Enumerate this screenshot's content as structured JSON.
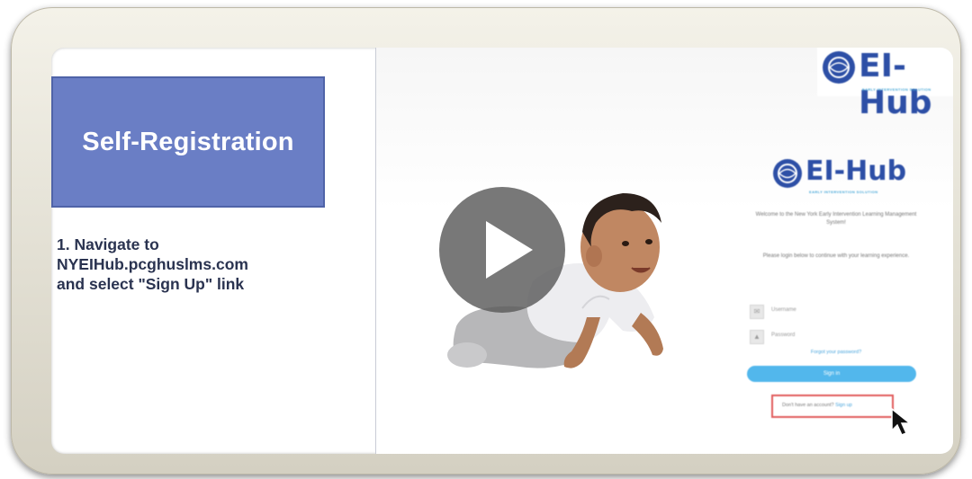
{
  "slide": {
    "title": "Self-Registration",
    "step": "1. Navigate to\nNYEIHub.pcghuslms.com\nand select \"Sign Up\" link"
  },
  "logo": {
    "brand": "EI-Hub",
    "tagline": "EARLY INTERVENTION SOLUTION"
  },
  "login": {
    "welcome": "Welcome to the New York Early Intervention Learning Management System!",
    "instructions": "Please login below to continue with your learning experience.",
    "username_placeholder": "Username",
    "password_placeholder": "Password",
    "forgot_link": "Forgot your password?",
    "signin_button": "Sign in",
    "signup_prompt": "Don't have an account?",
    "signup_link": "Sign up"
  },
  "colors": {
    "title_box": "#6a7ec5",
    "title_text": "#ffffff",
    "step_text": "#2a3350",
    "brand_blue": "#2d4fa6",
    "signin_blue": "#52b7ec",
    "highlight_red": "#e15b5b"
  },
  "icons": {
    "play": "play-icon",
    "cursor": "mouse-pointer-icon",
    "username": "user-icon",
    "password": "lock-icon"
  }
}
